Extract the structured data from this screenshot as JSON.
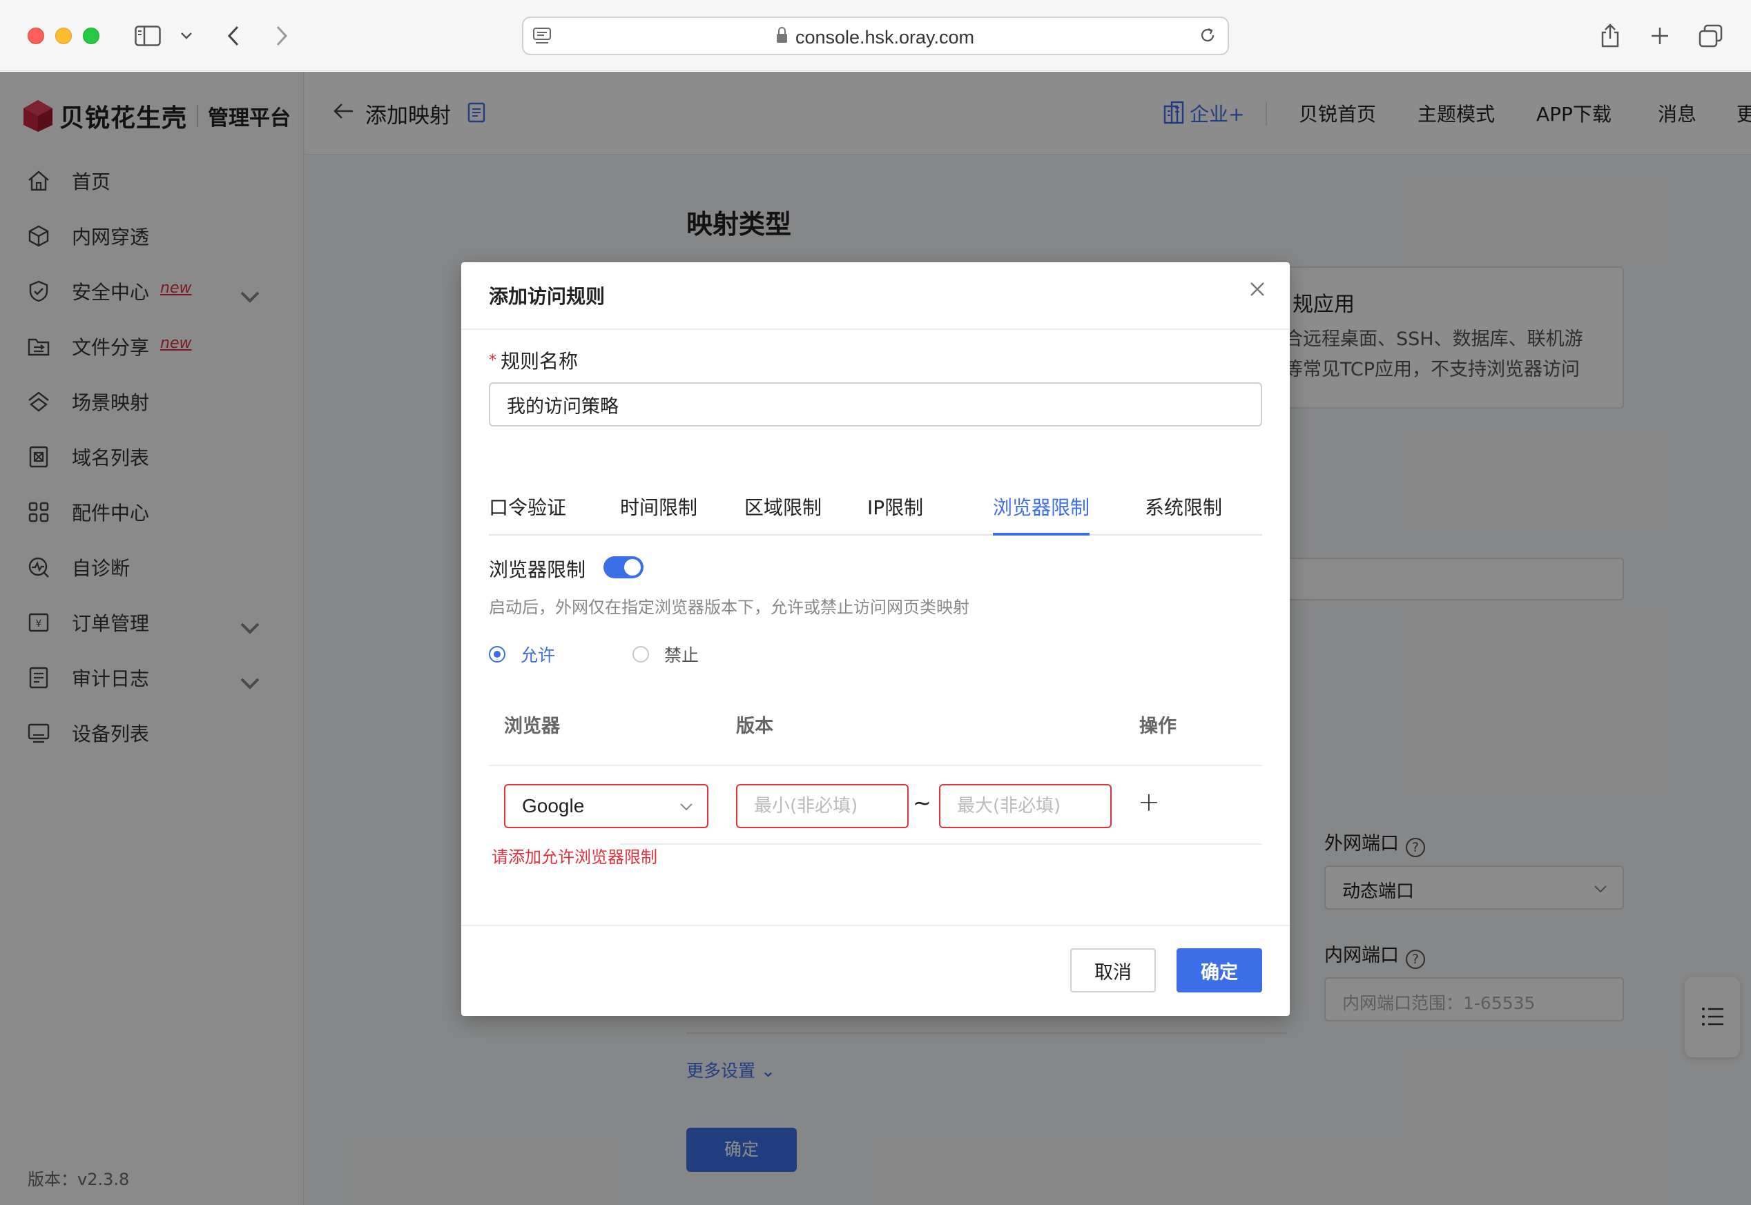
{
  "browser": {
    "url": "console.hsk.oray.com"
  },
  "brand": {
    "name": "贝锐花生壳",
    "subtitle": "管理平台",
    "color": "#c8243a"
  },
  "sidebar": {
    "items": [
      {
        "label": "首页",
        "icon": "home-icon"
      },
      {
        "label": "内网穿透",
        "icon": "cube-icon"
      },
      {
        "label": "安全中心",
        "icon": "shield-icon",
        "badge": "new",
        "expandable": true
      },
      {
        "label": "文件分享",
        "icon": "folder-share-icon",
        "badge": "new"
      },
      {
        "label": "场景映射",
        "icon": "scene-icon"
      },
      {
        "label": "域名列表",
        "icon": "domain-icon"
      },
      {
        "label": "配件中心",
        "icon": "grid-icon"
      },
      {
        "label": "自诊断",
        "icon": "diagnose-icon"
      },
      {
        "label": "订单管理",
        "icon": "order-icon",
        "expandable": true
      },
      {
        "label": "审计日志",
        "icon": "log-icon",
        "expandable": true
      },
      {
        "label": "设备列表",
        "icon": "device-icon"
      }
    ],
    "version": "版本：v2.3.8"
  },
  "topbar": {
    "title": "添加映射",
    "links": {
      "enterprise": "企业+",
      "home": "贝锐首页",
      "theme": "主题模式",
      "app": "APP下载",
      "messages": "消息",
      "more": "更"
    }
  },
  "background": {
    "section_title": "映射类型",
    "card_heading": "规应用",
    "card_line1": "合远程桌面、SSH、数据库、联机游",
    "card_line2": "等常见TCP应用，不支持浏览器访问",
    "ext_port_label": "外网端口",
    "ext_port_value": "动态端口",
    "int_port_label": "内网端口",
    "int_port_placeholder": "内网端口范围：1-65535",
    "more_settings": "更多设置",
    "confirm": "确定"
  },
  "modal": {
    "title": "添加访问规则",
    "rule_name_label": "规则名称",
    "rule_name_value": "我的访问策略",
    "tabs": [
      "口令验证",
      "时间限制",
      "区域限制",
      "IP限制",
      "浏览器限制",
      "系统限制"
    ],
    "active_tab": "浏览器限制",
    "switch_label": "浏览器限制",
    "switch_on": true,
    "hint": "启动后，外网仅在指定浏览器版本下，允许或禁止访问网页类映射",
    "radio_allow": "允许",
    "radio_deny": "禁止",
    "table": {
      "col_browser": "浏览器",
      "col_version": "版本",
      "col_action": "操作",
      "browser_value": "Google",
      "min_placeholder": "最小(非必填)",
      "max_placeholder": "最大(非必填)",
      "separator": "~",
      "add": "+"
    },
    "error": "请添加允许浏览器限制",
    "cancel": "取消",
    "ok": "确定"
  },
  "colors": {
    "primary": "#3c6ee8",
    "error": "#e0313c"
  }
}
